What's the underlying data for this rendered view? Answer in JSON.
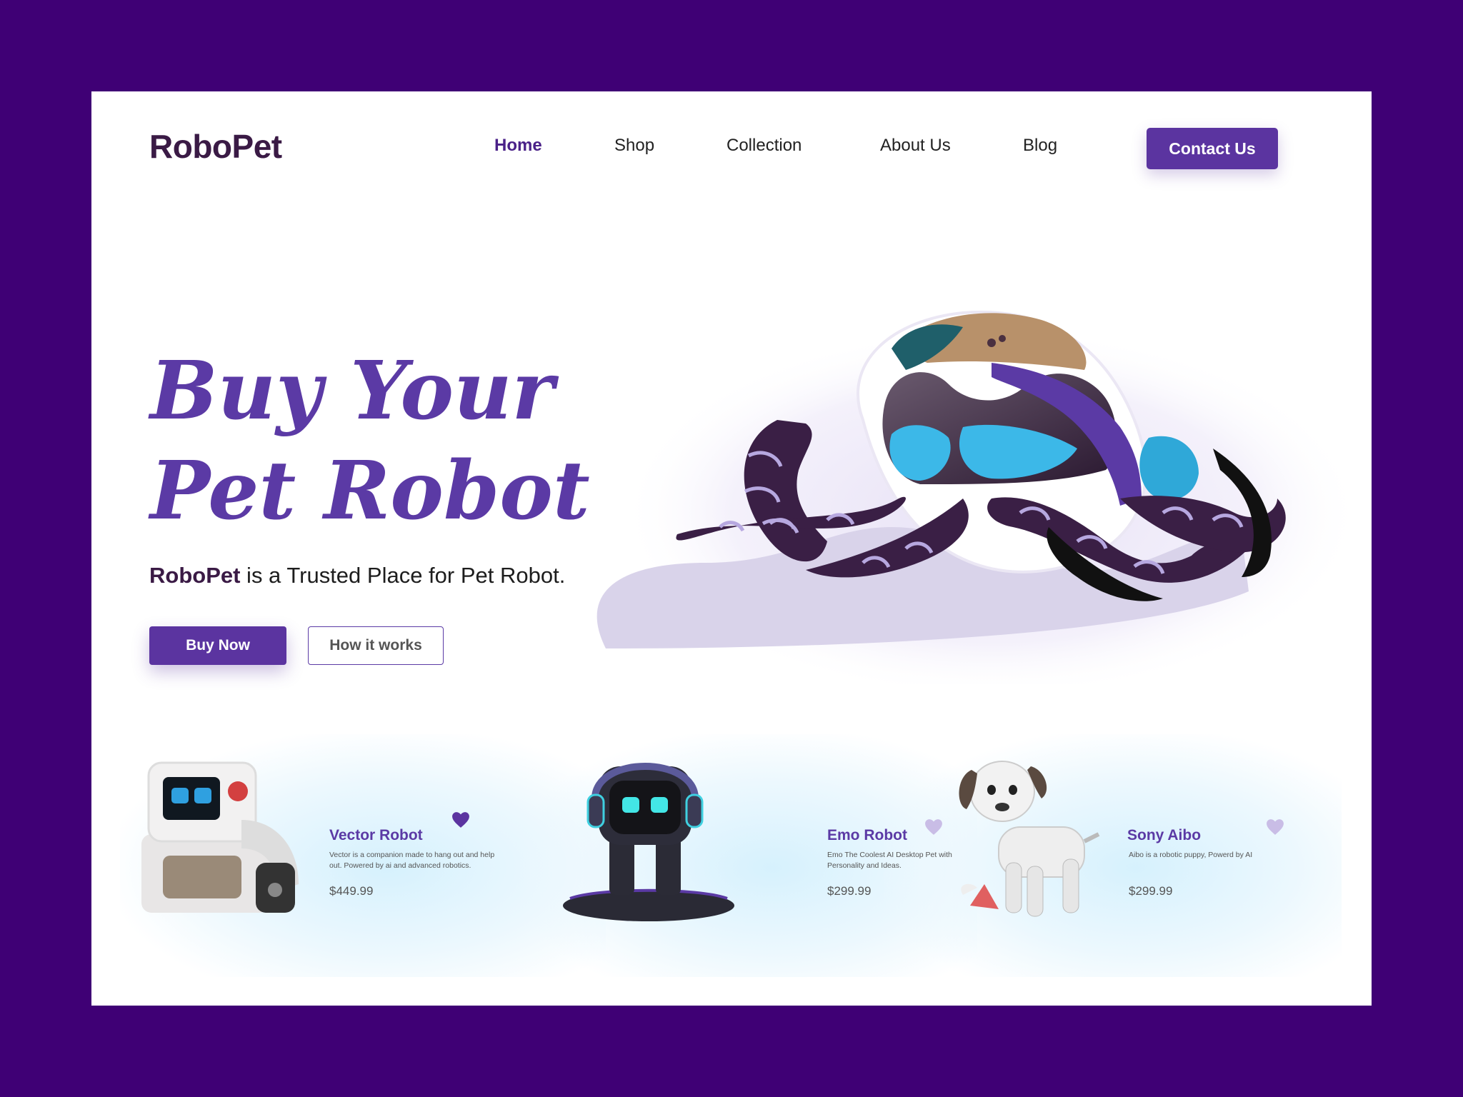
{
  "brand": {
    "name": "RoboPet"
  },
  "nav": {
    "items": [
      {
        "label": "Home",
        "active": true
      },
      {
        "label": "Shop",
        "active": false
      },
      {
        "label": "Collection",
        "active": false
      },
      {
        "label": "About Us",
        "active": false
      },
      {
        "label": "Blog",
        "active": false
      }
    ],
    "contact_label": "Contact Us"
  },
  "hero": {
    "title_line1": "Buy Your",
    "title_line2": "Pet Robot",
    "subtitle_brand": "RoboPet",
    "subtitle_rest": " is a Trusted Place for Pet Robot.",
    "buy_label": "Buy Now",
    "how_label": "How it works"
  },
  "products": [
    {
      "name": "Vector Robot",
      "description": "Vector is a companion made to hang out and help out. Powered by ai and advanced robotics.",
      "price": "$449.99",
      "favorited": true,
      "image": "vector-robot-image"
    },
    {
      "name": "Emo Robot",
      "description": "Emo The Coolest AI Desktop Pet with Personality and Ideas.",
      "price": "$299.99",
      "favorited": false,
      "image": "emo-robot-image"
    },
    {
      "name": "Sony Aibo",
      "description": "Aibo is a robotic puppy, Powerd by AI",
      "price": "$299.99",
      "favorited": false,
      "image": "sony-aibo-image"
    }
  ],
  "colors": {
    "frame": "#3f0075",
    "accent": "#5b34a0",
    "title": "#5b3aa5",
    "heart_active": "#5b34a0",
    "heart_inactive": "#c9bde6"
  }
}
